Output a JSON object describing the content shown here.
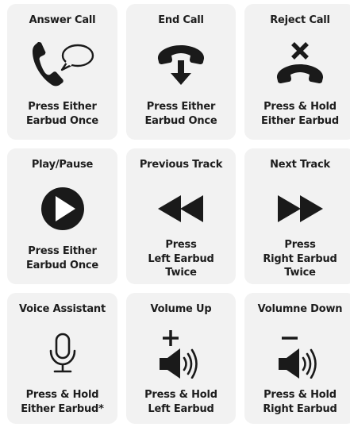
{
  "controls": [
    {
      "title": "Answer Call",
      "lines": [
        "Press Either",
        "Earbud Once"
      ]
    },
    {
      "title": "End Call",
      "lines": [
        "Press Either",
        "Earbud Once"
      ]
    },
    {
      "title": "Reject Call",
      "lines": [
        "Press & Hold",
        "Either Earbud"
      ]
    },
    {
      "title": "Play/Pause",
      "lines": [
        "Press Either",
        "Earbud Once"
      ]
    },
    {
      "title": "Previous Track",
      "lines": [
        "Press",
        "Left Earbud",
        "Twice"
      ]
    },
    {
      "title": "Next Track",
      "lines": [
        "Press",
        "Right Earbud",
        "Twice"
      ]
    },
    {
      "title": "Voice Assistant",
      "lines": [
        "Press & Hold",
        "Either Earbud*"
      ]
    },
    {
      "title": "Volume Up",
      "lines": [
        "Press & Hold",
        "Left Earbud"
      ]
    },
    {
      "title": "Volumne Down",
      "lines": [
        "Press & Hold",
        "Right Earbud"
      ]
    }
  ],
  "icons": [
    "phone-speech-icon",
    "hang-up-arrow-icon",
    "reject-call-icon",
    "play-icon",
    "rewind-icon",
    "fast-forward-icon",
    "microphone-icon",
    "volume-up-icon",
    "volume-down-icon"
  ],
  "colors": {
    "card": "#f2f2f2",
    "text": "#1d1d1d",
    "icon": "#1a1a1a"
  }
}
